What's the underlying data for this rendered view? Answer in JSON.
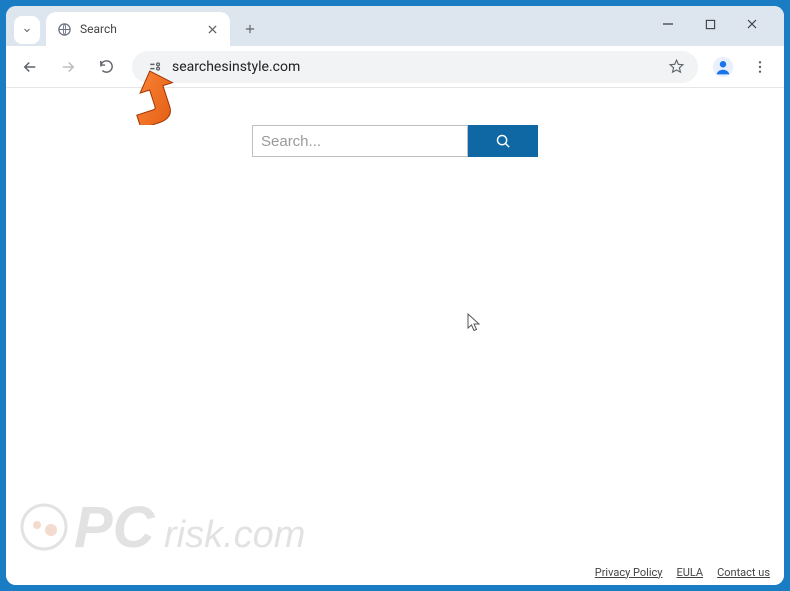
{
  "browser": {
    "tab_title": "Search",
    "url": "searchesinstyle.com"
  },
  "page": {
    "search_placeholder": "Search..."
  },
  "footer": {
    "privacy": "Privacy Policy",
    "eula": "EULA",
    "contact": "Contact us"
  },
  "watermark": {
    "text_main": "PC",
    "text_sub": "risk.com"
  }
}
